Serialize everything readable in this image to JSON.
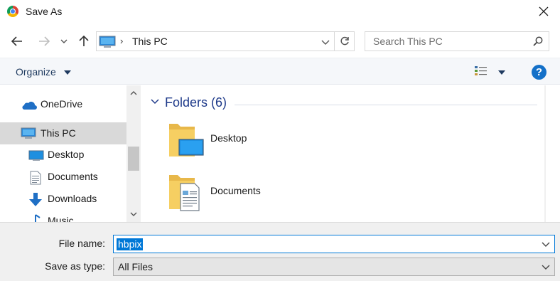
{
  "window": {
    "title": "Save As"
  },
  "address": {
    "crumb": "This PC"
  },
  "search": {
    "placeholder": "Search This PC"
  },
  "toolbar": {
    "organize_label": "Organize",
    "help_label": "?"
  },
  "sidebar": {
    "items": [
      {
        "label": "OneDrive",
        "icon": "onedrive-icon"
      },
      {
        "label": "This PC",
        "icon": "this-pc-icon",
        "selected": true
      },
      {
        "label": "Desktop",
        "icon": "desktop-icon"
      },
      {
        "label": "Documents",
        "icon": "documents-icon"
      },
      {
        "label": "Downloads",
        "icon": "downloads-icon"
      },
      {
        "label": "Music",
        "icon": "music-icon"
      }
    ]
  },
  "content": {
    "group_title": "Folders (6)",
    "folders": [
      {
        "label": "Desktop",
        "icon": "desktop-folder-icon"
      },
      {
        "label": "Documents",
        "icon": "documents-folder-icon"
      }
    ]
  },
  "form": {
    "file_name_label": "File name:",
    "file_name_value": "hbpix",
    "type_label": "Save as type:",
    "type_value": "All Files"
  },
  "colors": {
    "accent": "#0078d7",
    "folder_yellow": "#f6cf62",
    "link_blue": "#1e3a8a",
    "help_blue": "#1470c8"
  }
}
